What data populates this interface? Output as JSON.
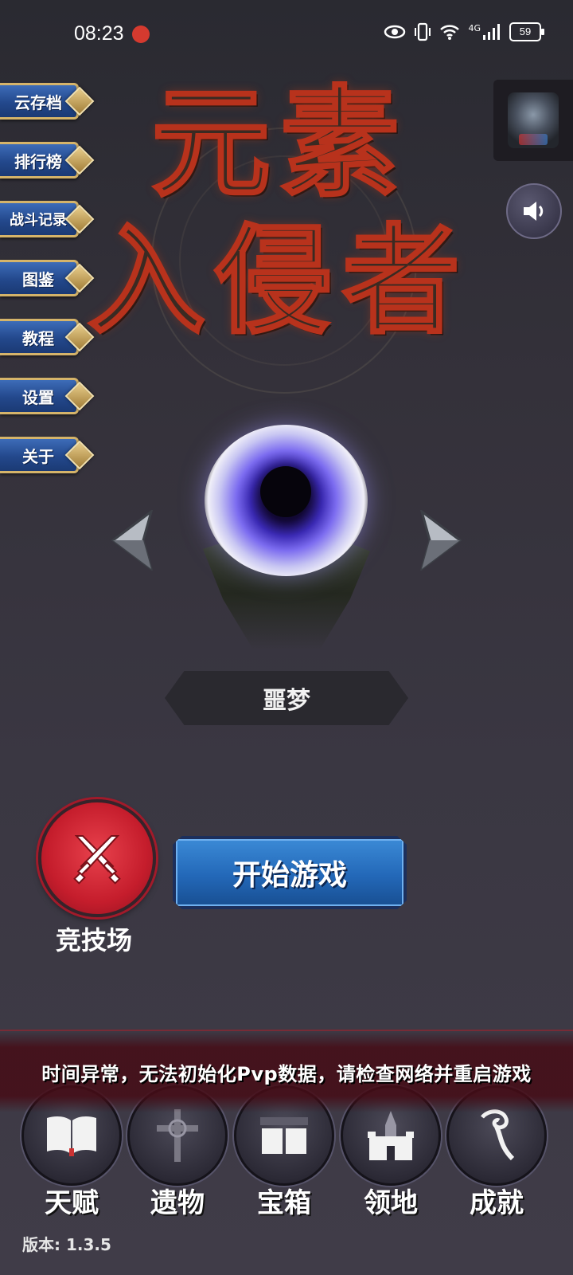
{
  "status_bar": {
    "time": "08:23",
    "network": "4G",
    "battery": "59"
  },
  "title": {
    "line1": "元素",
    "line2": "入侵者"
  },
  "side_menu": [
    {
      "label": "云存档",
      "icon": "cloud-save"
    },
    {
      "label": "排行榜",
      "icon": "leaderboard"
    },
    {
      "label": "战斗记录",
      "icon": "battle-log"
    },
    {
      "label": "图鉴",
      "icon": "codex"
    },
    {
      "label": "教程",
      "icon": "tutorial"
    },
    {
      "label": "设置",
      "icon": "settings"
    },
    {
      "label": "关于",
      "icon": "about"
    }
  ],
  "stage": {
    "name": "噩梦"
  },
  "actions": {
    "arena_label": "竞技场",
    "start_label": "开始游戏"
  },
  "toast": {
    "message": "时间异常，无法初始化Pvp数据，请检查网络并重启游戏"
  },
  "bottom_nav": [
    {
      "label": "天赋",
      "icon": "book-icon"
    },
    {
      "label": "遗物",
      "icon": "cross-relic-icon"
    },
    {
      "label": "宝箱",
      "icon": "chest-icon"
    },
    {
      "label": "领地",
      "icon": "castle-icon"
    },
    {
      "label": "成就",
      "icon": "achievement-icon"
    }
  ],
  "version": "版本: 1.3.5",
  "colors": {
    "menu_blue": "#23488c",
    "menu_gold": "#d5b46a",
    "arena_red": "#c51d2c",
    "start_blue": "#2368b8",
    "title_red": "#b8321c"
  }
}
